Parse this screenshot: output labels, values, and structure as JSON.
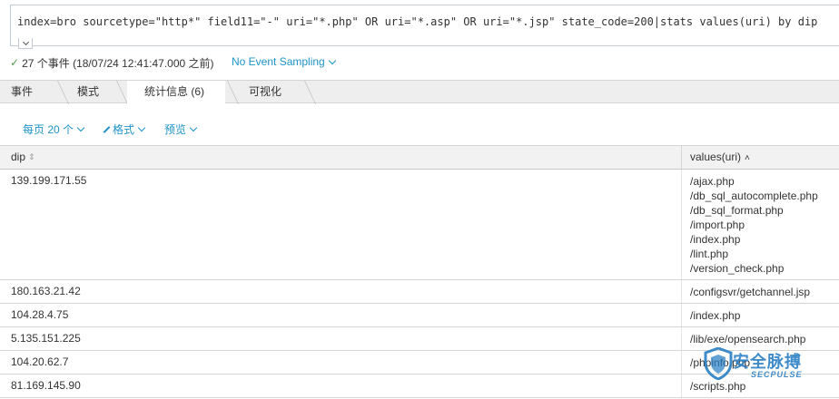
{
  "search": {
    "query": "index=bro sourcetype=\"http*\" field11=\"-\" uri=\"*.php\" OR uri=\"*.asp\" OR uri=\"*.jsp\" state_code=200|stats values(uri) by dip"
  },
  "status": {
    "check_icon": "check-icon",
    "events_text": "27 个事件 (18/07/24 12:41:47.000 之前)",
    "sampling_label": "No Event Sampling"
  },
  "tabs": [
    {
      "label": "事件",
      "active": false
    },
    {
      "label": "模式",
      "active": false
    },
    {
      "label": "统计信息 (6)",
      "active": true
    },
    {
      "label": "可视化",
      "active": false
    }
  ],
  "toolbar": {
    "per_page_label": "每页 20 个",
    "format_label": "格式",
    "preview_label": "预览"
  },
  "table": {
    "columns": [
      {
        "label": "dip",
        "sort": "none"
      },
      {
        "label": "values(uri)",
        "sort": "asc"
      }
    ],
    "rows": [
      {
        "dip": "139.199.171.55",
        "uris": [
          "/ajax.php",
          "/db_sql_autocomplete.php",
          "/db_sql_format.php",
          "/import.php",
          "/index.php",
          "/lint.php",
          "/version_check.php"
        ]
      },
      {
        "dip": "180.163.21.42",
        "uris": [
          "/configsvr/getchannel.jsp"
        ]
      },
      {
        "dip": "104.28.4.75",
        "uris": [
          "/index.php"
        ]
      },
      {
        "dip": "5.135.151.225",
        "uris": [
          "/lib/exe/opensearch.php"
        ]
      },
      {
        "dip": "104.20.62.7",
        "uris": [
          "/phpinfo.php"
        ]
      },
      {
        "dip": "81.169.145.90",
        "uris": [
          "/scripts.php"
        ]
      }
    ]
  },
  "watermark": {
    "title": "安全脉搏",
    "subtitle": "SECPULSE"
  },
  "colors": {
    "link": "#1e93c6",
    "check": "#53a051",
    "watermark": "#2a7fc4"
  }
}
